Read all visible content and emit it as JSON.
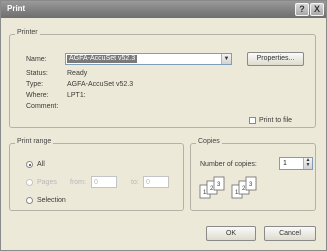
{
  "window": {
    "title": "Print",
    "help_glyph": "?",
    "close_glyph": "X"
  },
  "printer": {
    "group_label": "Printer",
    "name_label": "Name:",
    "name_value": "AGFA-AccuSet v52.3",
    "properties_label": "Properties...",
    "status_label": "Status:",
    "status_value": "Ready",
    "type_label": "Type:",
    "type_value": "AGFA-AccuSet v52.3",
    "where_label": "Where:",
    "where_value": "LPT1:",
    "comment_label": "Comment:",
    "print_to_file_label": "Print to file",
    "print_to_file_checked": false
  },
  "print_range": {
    "group_label": "Print range",
    "all_label": "All",
    "pages_label": "Pages",
    "from_label": "from:",
    "from_value": "0",
    "to_label": "to:",
    "to_value": "0",
    "selection_label": "Selection",
    "selected": "all"
  },
  "copies": {
    "group_label": "Copies",
    "number_label": "Number of copies:",
    "number_value": "1",
    "collate_pages": [
      "1",
      "2",
      "3"
    ]
  },
  "buttons": {
    "ok_label": "OK",
    "cancel_label": "Cancel"
  }
}
